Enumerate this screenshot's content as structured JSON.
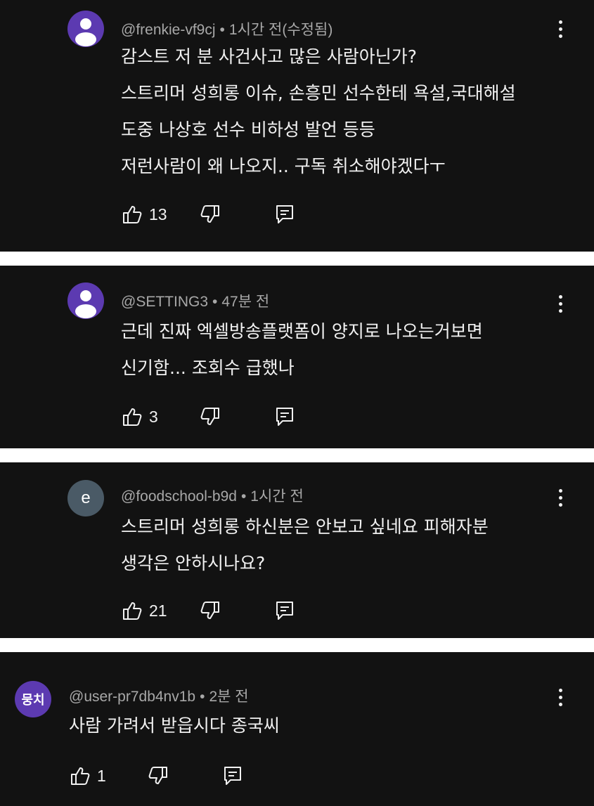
{
  "comments": [
    {
      "author": "@frenkie-vf9cj",
      "time": "1시간 전(수정됨)",
      "lines": [
        "감스트 저 분 사건사고 많은 사람아닌가?",
        "스트리머 성희롱 이슈, 손흥민 선수한테 욕설,국대해설",
        "도중 나상호 선수 비하성 발언 등등",
        "저런사람이 왜 나오지.. 구독 취소해야겠다ㅜ"
      ],
      "likes": "13",
      "avatar": {
        "type": "person-icon",
        "color": "#5c3ab1"
      }
    },
    {
      "author": "@SETTING3",
      "time": "47분 전",
      "lines": [
        "근데 진짜 엑셀방송플랫폼이 양지로 나오는거보면",
        "신기함... 조회수 급했나"
      ],
      "likes": "3",
      "avatar": {
        "type": "person-icon",
        "color": "#5c3ab1"
      }
    },
    {
      "author": "@foodschool-b9d",
      "time": "1시간 전",
      "lines": [
        "스트리머 성희롱 하신분은 안보고 싶네요 피해자분",
        "생각은 안하시나요?"
      ],
      "likes": "21",
      "avatar": {
        "type": "letter",
        "text": "e",
        "color": "#4a5a66"
      }
    },
    {
      "author": "@user-pr7db4nv1b",
      "time": "2분 전",
      "lines": [
        "사람 가려서 받읍시다 종국씨"
      ],
      "likes": "1",
      "avatar": {
        "type": "text",
        "text": "뭉치",
        "color": "#5c3ab1"
      }
    }
  ],
  "separator": " • "
}
